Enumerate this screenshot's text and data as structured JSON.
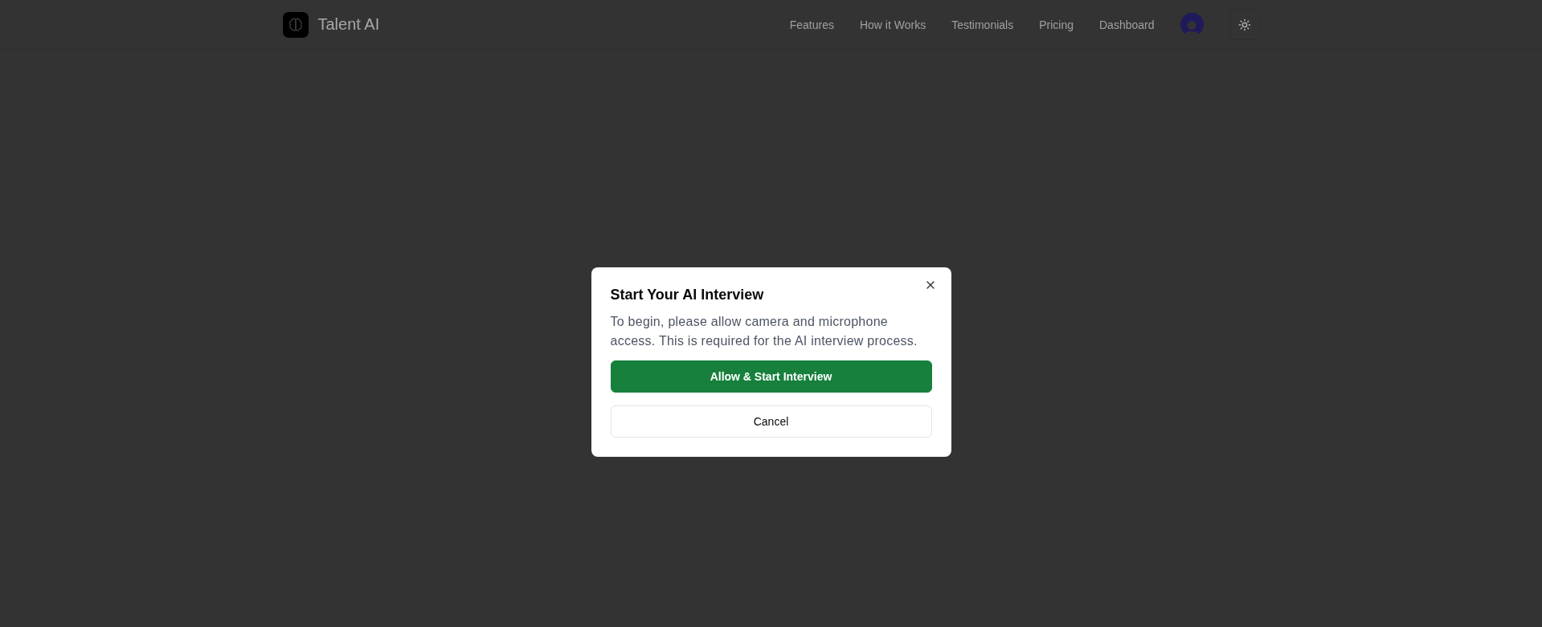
{
  "header": {
    "brand": "Talent AI",
    "nav": [
      "Features",
      "How it Works",
      "Testimonials",
      "Pricing",
      "Dashboard"
    ]
  },
  "dialog": {
    "title": "Start Your AI Interview",
    "message": "To begin, please allow camera and microphone access. This is required for the AI interview process.",
    "buttons": [
      {
        "label": "Allow & Start Interview",
        "kind": "primary"
      },
      {
        "label": "Cancel",
        "kind": "secondary"
      }
    ]
  }
}
